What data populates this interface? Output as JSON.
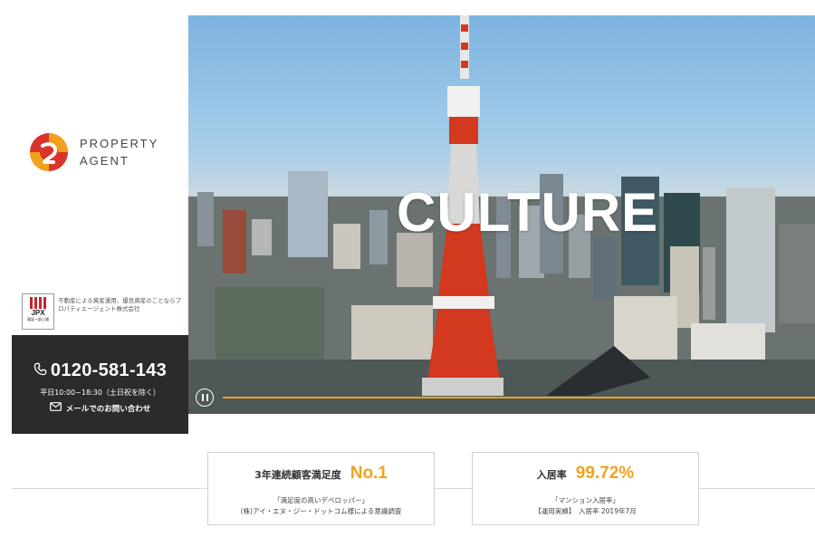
{
  "brand": {
    "logo_line1": "PROPERTY",
    "logo_line2": "AGENT",
    "colors": {
      "red": "#d9342b",
      "orange": "#f1a21d"
    }
  },
  "listing": {
    "jpx_main": "JPX",
    "jpx_sub": "東証一部上場",
    "note": "不動産による資産運用、優良資産のことならプロパティエージェント株式会社"
  },
  "contact": {
    "phone_icon": "phone-icon",
    "phone": "0120-581-143",
    "hours": "平日10:00~18:30（土日祝を除く）",
    "mail_icon": "mail-icon",
    "mail_label": "メールでのお問い合わせ"
  },
  "hero": {
    "title": "CULTURE",
    "scene": "Tokyo Tower city skyline",
    "pause_icon": "pause-icon",
    "progress": 1.0
  },
  "stats": [
    {
      "label": "3年連続顧客満足度",
      "value": "No.1",
      "note1": "「満足度の高いデベロッパー」",
      "note2": "(株)アイ・エヌ・ジー・ドットコム様による意識調査"
    },
    {
      "label": "入居率",
      "value": "99.72%",
      "note1": "「マンション入居率」",
      "note2": "【運用実績】　入居率 2019年7月"
    }
  ]
}
